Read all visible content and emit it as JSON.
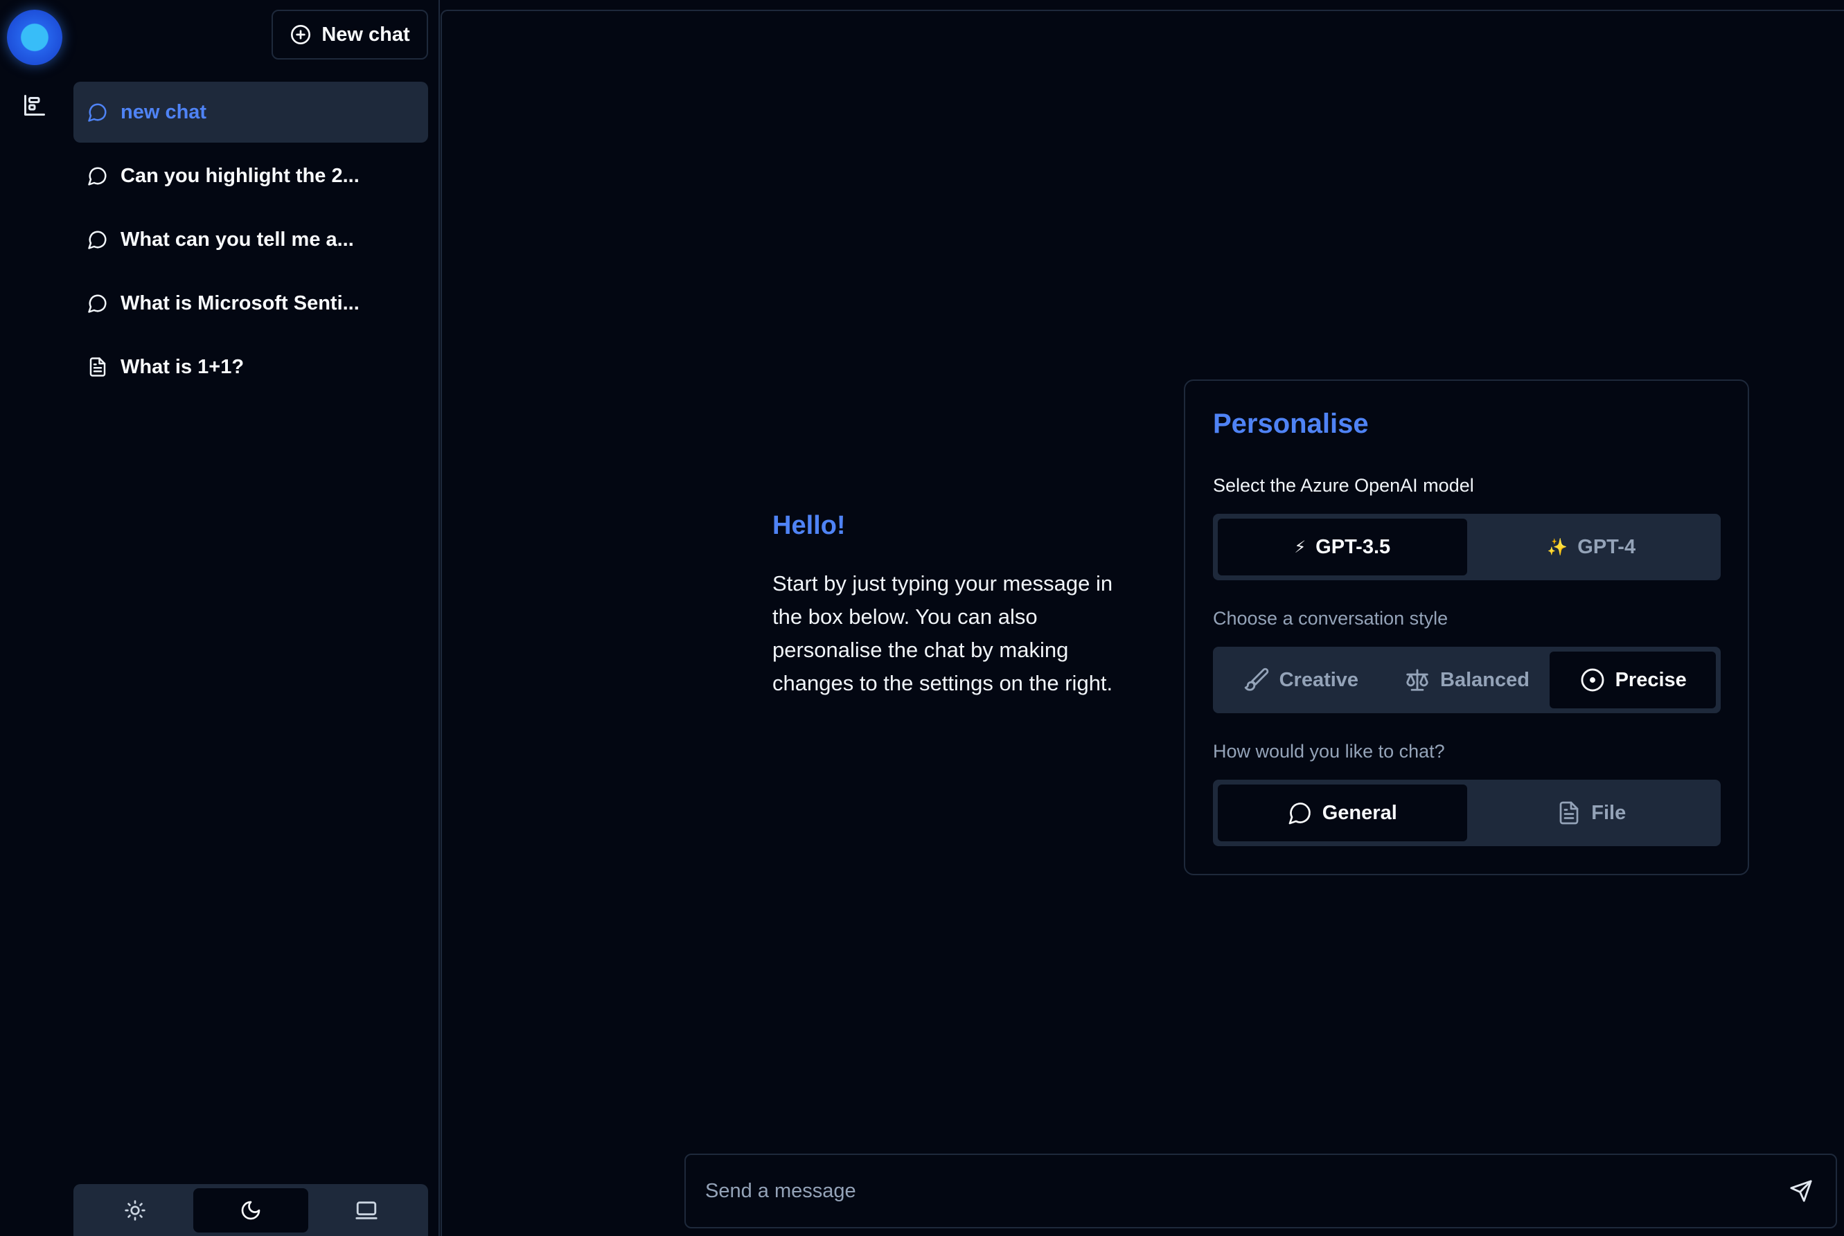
{
  "sidebar": {
    "new_chat_label": "New chat",
    "chats": [
      {
        "label": "new chat",
        "icon": "message-circle-icon",
        "active": true
      },
      {
        "label": "Can you highlight the 2...",
        "icon": "message-circle-icon",
        "active": false
      },
      {
        "label": "What can you tell me a...",
        "icon": "message-circle-icon",
        "active": false
      },
      {
        "label": "What is Microsoft Senti...",
        "icon": "message-circle-icon",
        "active": false
      },
      {
        "label": "What is 1+1?",
        "icon": "file-text-icon",
        "active": false
      }
    ],
    "theme_options": [
      {
        "name": "light",
        "icon": "sun-icon",
        "active": false
      },
      {
        "name": "dark",
        "icon": "moon-icon",
        "active": true
      },
      {
        "name": "system",
        "icon": "laptop-icon",
        "active": false
      }
    ]
  },
  "welcome": {
    "title": "Hello!",
    "body": "Start by just typing your message in the box below. You can also personalise the chat by making changes to the settings on the right."
  },
  "personalise": {
    "title": "Personalise",
    "model_label": "Select the Azure OpenAI model",
    "models": [
      {
        "label": "GPT-3.5",
        "emoji": "⚡",
        "active": true
      },
      {
        "label": "GPT-4",
        "emoji": "✨",
        "active": false
      }
    ],
    "style_label": "Choose a conversation style",
    "styles": [
      {
        "label": "Creative",
        "icon": "brush-icon",
        "active": false
      },
      {
        "label": "Balanced",
        "icon": "scale-icon",
        "active": false
      },
      {
        "label": "Precise",
        "icon": "target-icon",
        "active": true
      }
    ],
    "chat_type_label": "How would you like to chat?",
    "chat_types": [
      {
        "label": "General",
        "icon": "message-circle-icon",
        "active": true
      },
      {
        "label": "File",
        "icon": "file-text-icon",
        "active": false
      }
    ]
  },
  "composer": {
    "placeholder": "Send a message",
    "send_icon": "send-icon"
  },
  "colors": {
    "background": "#030712",
    "accent": "#4f83f5",
    "muted": "#1e293b"
  }
}
